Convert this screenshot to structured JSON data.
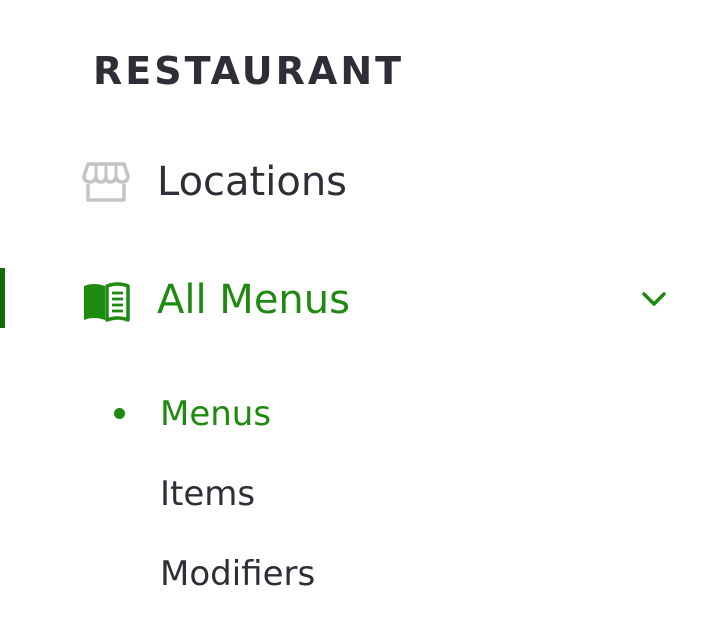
{
  "sidebar": {
    "section_title": "RESTAURANT",
    "items": [
      {
        "label": "Locations",
        "icon": "storefront-icon",
        "active": false
      },
      {
        "label": "All Menus",
        "icon": "menu-book-icon",
        "active": true,
        "expanded": true
      }
    ],
    "submenu": [
      {
        "label": "Menus",
        "active": true
      },
      {
        "label": "Items",
        "active": false
      },
      {
        "label": "Modifiers",
        "active": false
      }
    ]
  },
  "colors": {
    "accent": "#1f8a10",
    "active_bar": "#166b0c",
    "text": "#2e2f36",
    "icon_muted": "#c4c4c4"
  }
}
